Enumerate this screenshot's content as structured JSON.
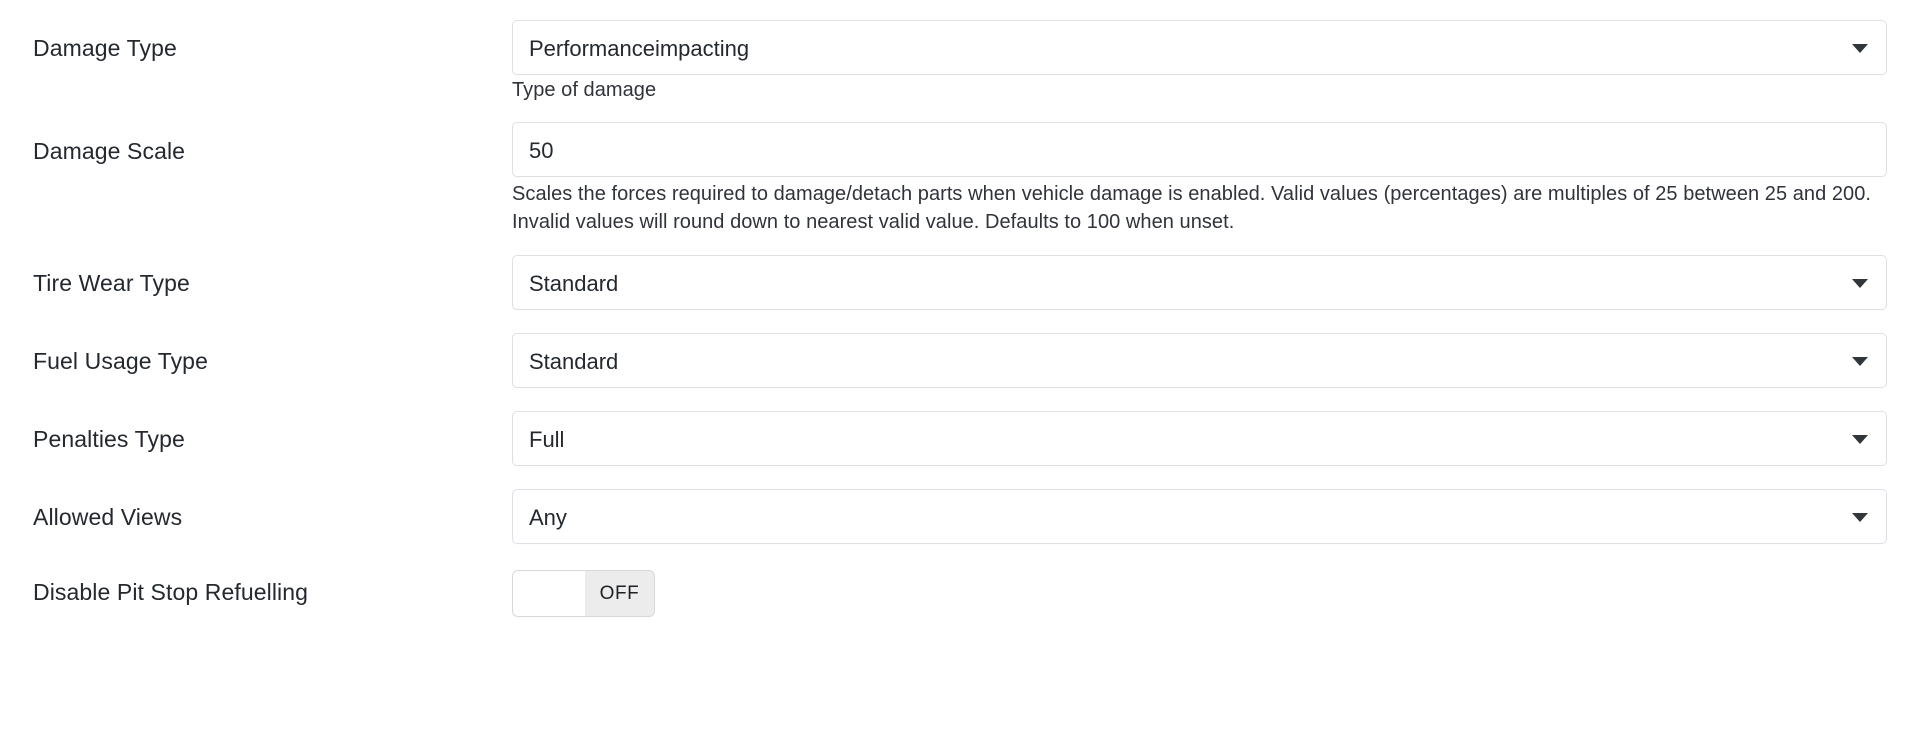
{
  "form": {
    "fields": [
      {
        "id": "damage-type",
        "label": "Damage Type",
        "type": "select",
        "value": "Performanceimpacting",
        "help": "Type of damage"
      },
      {
        "id": "damage-scale",
        "label": "Damage Scale",
        "type": "text",
        "value": "50",
        "help": "Scales the forces required to damage/detach parts when vehicle damage is enabled. Valid values (percentages) are multiples of 25 between 25 and 200. Invalid values will round down to nearest valid value. Defaults to 100 when unset."
      },
      {
        "id": "tire-wear-type",
        "label": "Tire Wear Type",
        "type": "select",
        "value": "Standard",
        "help": ""
      },
      {
        "id": "fuel-usage-type",
        "label": "Fuel Usage Type",
        "type": "select",
        "value": "Standard",
        "help": ""
      },
      {
        "id": "penalties-type",
        "label": "Penalties Type",
        "type": "select",
        "value": "Full",
        "help": ""
      },
      {
        "id": "allowed-views",
        "label": "Allowed Views",
        "type": "select",
        "value": "Any",
        "help": ""
      },
      {
        "id": "disable-pit-stop-refuelling",
        "label": "Disable Pit Stop Refuelling",
        "type": "toggle",
        "value": "OFF",
        "help": ""
      }
    ]
  },
  "icons": {
    "dropdown": "chevron-down-icon"
  },
  "colors": {
    "page_background": "#ffffff",
    "field_border": "#dde1e5",
    "label_text": "#24292f",
    "help_text": "#30343a",
    "caret": "#31363b",
    "toggle_track": "#ececec",
    "toggle_knob": "#ffffff"
  }
}
